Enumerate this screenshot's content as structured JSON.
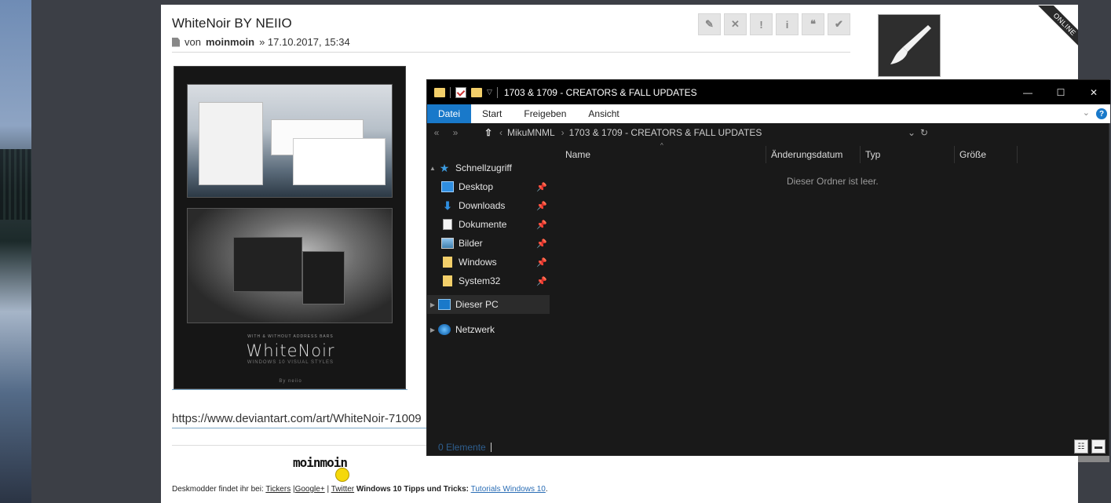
{
  "post": {
    "title": "WhiteNoir BY NEIIO",
    "meta_prefix": "von",
    "author": "moinmoin",
    "meta_date": "» 17.10.2017, 15:34",
    "actions": [
      "✎",
      "✕",
      "!",
      "i",
      "❝",
      "✔"
    ],
    "online_badge": "ONLINE",
    "link": "https://www.deviantart.com/art/WhiteNoir-71009",
    "screenshot": {
      "logo": "WhiteNoir",
      "tagline": "WITH & WITHOUT ADDRESS BARS",
      "subtitle": "WINDOWS 10 VISUAL STYLES",
      "credit": "By neiio"
    },
    "signature": {
      "logo": "moinmoin",
      "prefix": "Deskmodder findet ihr bei:",
      "link_tickers": "Tickers",
      "link_google": "Google+",
      "sep": "|",
      "link_twitter": "Twitter",
      "bold_text": "Windows 10 Tipps und Tricks:",
      "link_tutorials": "Tutorials Windows 10",
      "end": "."
    }
  },
  "explorer": {
    "title": "1703 & 1709 - CREATORS & FALL UPDATES",
    "window_buttons": [
      "—",
      "☐",
      "✕"
    ],
    "ribbon_tabs": [
      "Datei",
      "Start",
      "Freigeben",
      "Ansicht"
    ],
    "help_icon": "?",
    "address": {
      "root": "MikuMNML",
      "separator": "›",
      "folder": "1703 & 1709 - CREATORS & FALL UPDATES"
    },
    "nav": {
      "quick_access": "Schnellzugriff",
      "items": [
        "Desktop",
        "Downloads",
        "Dokumente",
        "Bilder",
        "Windows",
        "System32"
      ],
      "this_pc": "Dieser PC",
      "network": "Netzwerk"
    },
    "columns": [
      "Name",
      "Änderungsdatum",
      "Typ",
      "Größe"
    ],
    "empty_message": "Dieser Ordner ist leer.",
    "status": "0 Elemente"
  }
}
